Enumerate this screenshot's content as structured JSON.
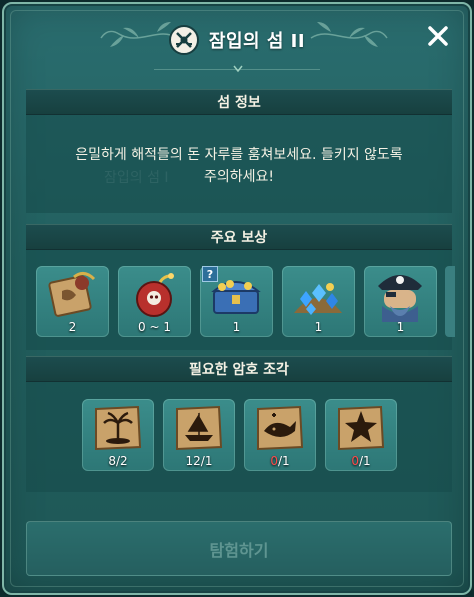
{
  "window": {
    "title": "잠입의 섬 II",
    "close_icon": "close-icon"
  },
  "island_info": {
    "header": "섬 정보",
    "description_line1": "은밀하게 해적들의 돈 자루를 훔쳐보세요. 들키지 않도록",
    "description_line2": "주의하세요!",
    "faint_background_text": "잠입의 섬 I"
  },
  "rewards": {
    "header": "주요 보상",
    "question_badge": "?",
    "items": [
      {
        "icon": "pirate-treasure-map-icon",
        "count": "2"
      },
      {
        "icon": "skull-bomb-icon",
        "count": "0 ~ 1"
      },
      {
        "icon": "gold-treasure-chest-icon",
        "count": "1"
      },
      {
        "icon": "blue-gem-pile-icon",
        "count": "1"
      },
      {
        "icon": "pirate-captain-portrait-icon",
        "count": "1"
      }
    ]
  },
  "code_pieces": {
    "header": "필요한 암호 조각",
    "items": [
      {
        "icon": "palm-island-map-piece-icon",
        "have": "8",
        "need": "/2",
        "insufficient": false
      },
      {
        "icon": "sailing-ship-map-piece-icon",
        "have": "12",
        "need": "/1",
        "insufficient": false
      },
      {
        "icon": "whale-map-piece-icon",
        "have": "0",
        "need": "/1",
        "insufficient": true
      },
      {
        "icon": "starfish-map-piece-icon",
        "have": "0",
        "need": "/1",
        "insufficient": true
      }
    ]
  },
  "actions": {
    "explore_label": "탐험하기",
    "explore_enabled": false
  },
  "colors": {
    "panel": "#22605f",
    "section_header": "#17403f",
    "slot": "#327f7e",
    "insufficient": "#ff4a4a",
    "disabled_text": "#5f9591"
  }
}
